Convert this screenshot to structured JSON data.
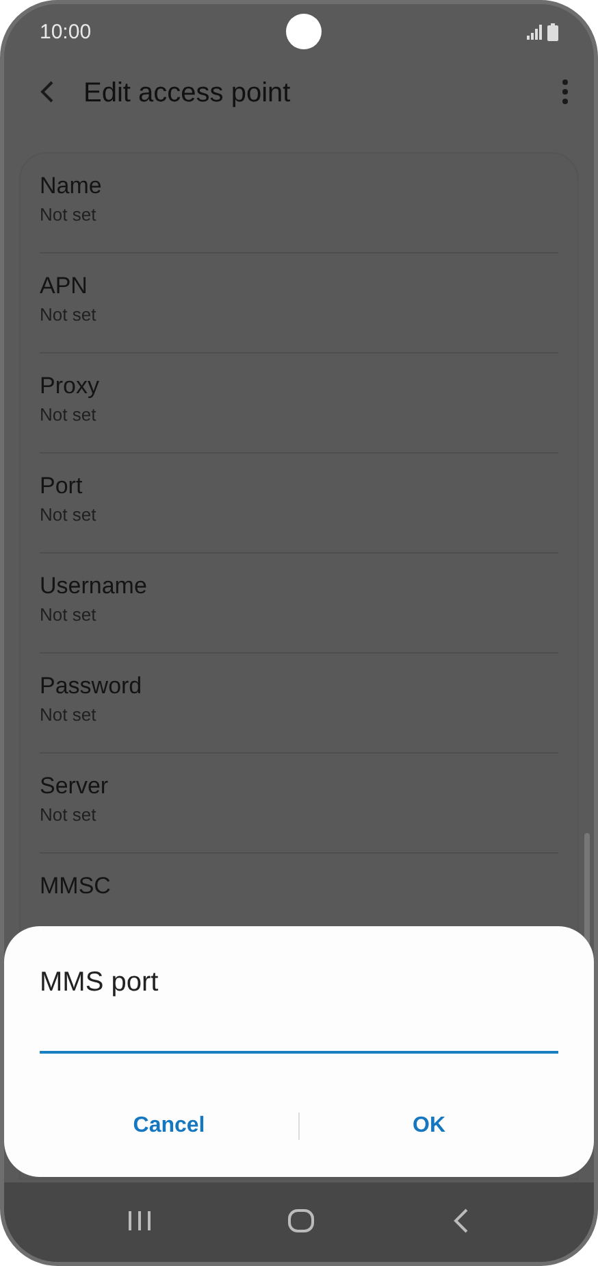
{
  "status_bar": {
    "time": "10:00"
  },
  "header": {
    "title": "Edit access point"
  },
  "settings": [
    {
      "label": "Name",
      "value": "Not set"
    },
    {
      "label": "APN",
      "value": "Not set"
    },
    {
      "label": "Proxy",
      "value": "Not set"
    },
    {
      "label": "Port",
      "value": "Not set"
    },
    {
      "label": "Username",
      "value": "Not set"
    },
    {
      "label": "Password",
      "value": "Not set"
    },
    {
      "label": "Server",
      "value": "Not set"
    },
    {
      "label": "MMSC"
    }
  ],
  "dialog": {
    "title": "MMS port",
    "input": {
      "focused": true
    },
    "buttons": [
      "Cancel",
      "OK"
    ]
  }
}
